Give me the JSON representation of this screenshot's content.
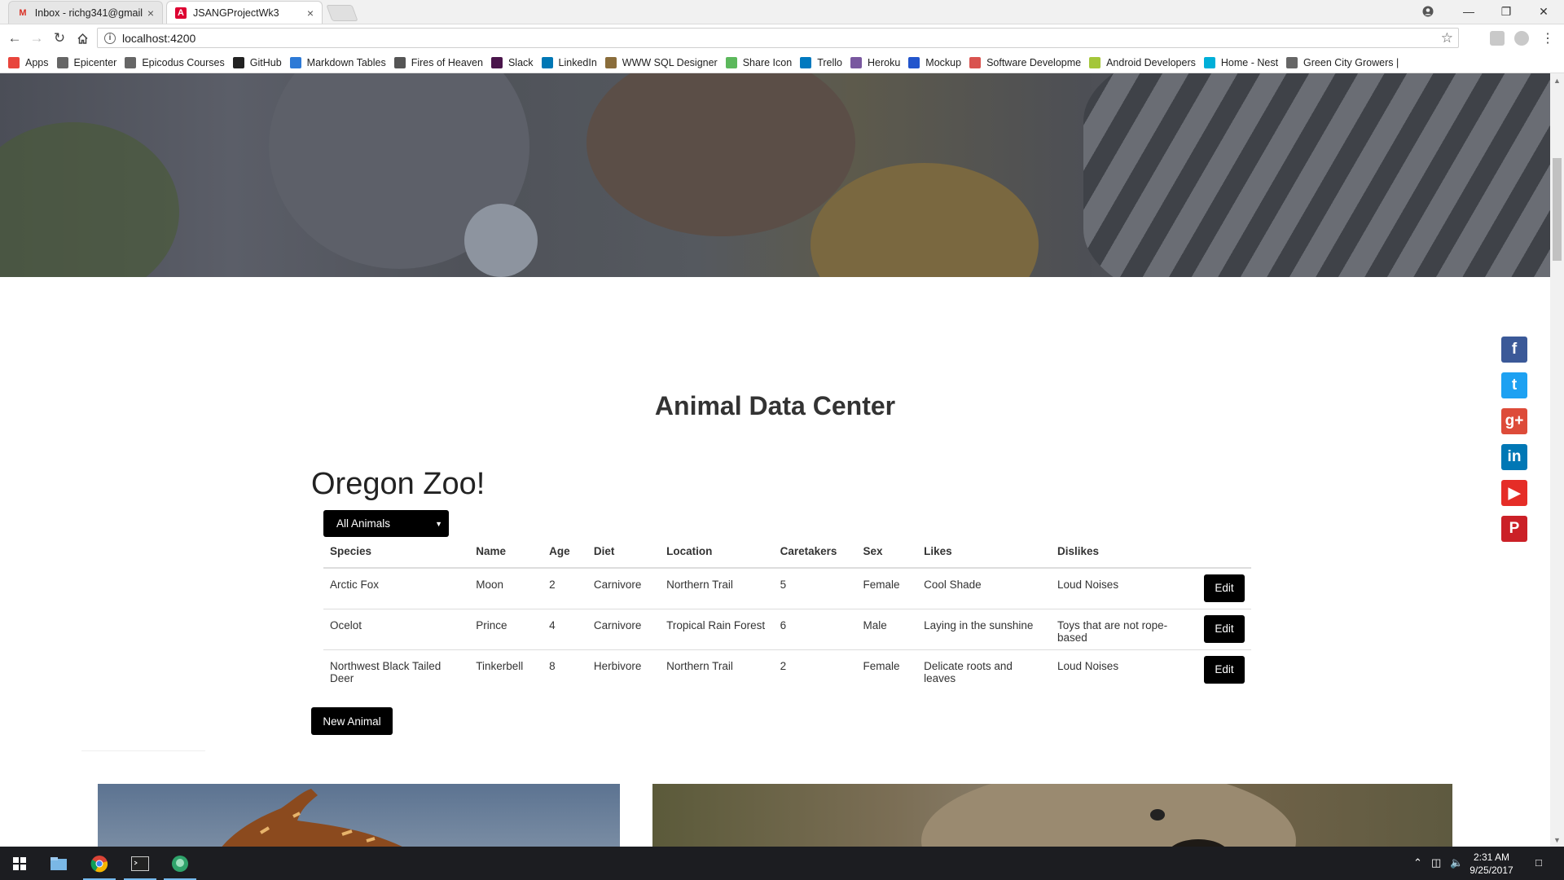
{
  "browser": {
    "tabs": [
      {
        "title": "Inbox - richg341@gmail",
        "favicon": "gmail-icon",
        "active": false
      },
      {
        "title": "JSANGProjectWk3",
        "favicon": "angular-icon",
        "active": true
      }
    ],
    "url": "localhost:4200",
    "bookmarks": [
      {
        "label": "Apps",
        "icon": "apps-grid-icon",
        "color": "#e8453c"
      },
      {
        "label": "Epicenter",
        "icon": "epicodus-icon",
        "color": "#666666"
      },
      {
        "label": "Epicodus Courses",
        "icon": "epicodus-icon",
        "color": "#666666"
      },
      {
        "label": "GitHub",
        "icon": "github-icon",
        "color": "#222222"
      },
      {
        "label": "Markdown Tables",
        "icon": "table-icon",
        "color": "#2d7ad6"
      },
      {
        "label": "Fires of Heaven",
        "icon": "wings-icon",
        "color": "#555555"
      },
      {
        "label": "Slack",
        "icon": "slack-icon",
        "color": "#4a154b"
      },
      {
        "label": "LinkedIn",
        "icon": "linkedin-icon",
        "color": "#0077b5"
      },
      {
        "label": "WWW SQL Designer",
        "icon": "avatar-icon",
        "color": "#8a6d3b"
      },
      {
        "label": "Share Icon",
        "icon": "share-icon",
        "color": "#5cb85c"
      },
      {
        "label": "Trello",
        "icon": "trello-icon",
        "color": "#0079bf"
      },
      {
        "label": "Heroku",
        "icon": "heroku-icon",
        "color": "#79589f"
      },
      {
        "label": "Mockup",
        "icon": "mockup-icon",
        "color": "#2255cc"
      },
      {
        "label": "Software Developme",
        "icon": "ad-icon",
        "color": "#d9534f"
      },
      {
        "label": "Android Developers",
        "icon": "android-icon",
        "color": "#a4c639"
      },
      {
        "label": "Home - Nest",
        "icon": "nest-icon",
        "color": "#00afd8"
      },
      {
        "label": "Green City Growers |",
        "icon": "growers-icon",
        "color": "#666666"
      }
    ]
  },
  "page": {
    "heading": "Animal Data Center",
    "zoo_name": "Oregon Zoo!",
    "filter": {
      "selected": "All Animals"
    },
    "table": {
      "headers": [
        "Species",
        "Name",
        "Age",
        "Diet",
        "Location",
        "Caretakers",
        "Sex",
        "Likes",
        "Dislikes"
      ],
      "rows": [
        {
          "species": "Arctic Fox",
          "name": "Moon",
          "age": "2",
          "diet": "Carnivore",
          "location": "Northern Trail",
          "caretakers": "5",
          "sex": "Female",
          "likes": "Cool Shade",
          "dislikes": "Loud Noises"
        },
        {
          "species": "Ocelot",
          "name": "Prince",
          "age": "4",
          "diet": "Carnivore",
          "location": "Tropical Rain Forest",
          "caretakers": "6",
          "sex": "Male",
          "likes": "Laying in the sunshine",
          "dislikes": "Toys that are not rope-based"
        },
        {
          "species": "Northwest Black Tailed Deer",
          "name": "Tinkerbell",
          "age": "8",
          "diet": "Herbivore",
          "location": "Northern Trail",
          "caretakers": "2",
          "sex": "Female",
          "likes": "Delicate roots and leaves",
          "dislikes": "Loud Noises"
        }
      ],
      "edit_label": "Edit"
    },
    "new_animal_label": "New Animal",
    "social": [
      {
        "icon": "facebook-icon",
        "color": "#3b5998"
      },
      {
        "icon": "twitter-icon",
        "color": "#1da1f2"
      },
      {
        "icon": "google-plus-icon",
        "color": "#dd4b39"
      },
      {
        "icon": "linkedin-icon",
        "color": "#0077b5"
      },
      {
        "icon": "youtube-icon",
        "color": "#e52d27"
      },
      {
        "icon": "pinterest-icon",
        "color": "#cb2027"
      }
    ]
  },
  "taskbar": {
    "time": "2:31 AM",
    "date": "9/25/2017"
  }
}
